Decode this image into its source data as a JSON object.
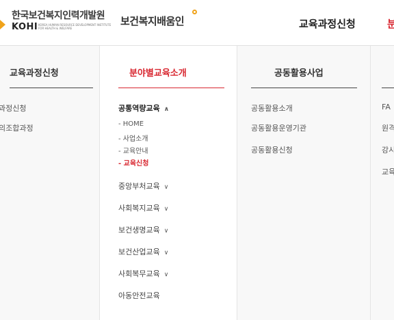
{
  "header": {
    "logo_kr": "한국보건복지인력개발원",
    "logo_en": "KOHI",
    "logo_sub": "KOREA HUMAN RESOURCE DEVELOPMENT INSTITUTE FOR HEALTH & WELFARE",
    "brand": "보건복지배움인",
    "nav_apply": "교육과정신청",
    "nav_next": "분"
  },
  "menu": {
    "col1": {
      "title": "교육과정신청",
      "items": [
        "과정신청",
        "의조합과정"
      ]
    },
    "col2": {
      "title": "분야별교육소개",
      "open_category": "공통역량교육",
      "open_chevron": "∧",
      "subitems": [
        "- HOME",
        "- 사업소개",
        "- 교육안내",
        "- 교육신청"
      ],
      "active_subitem": "- 교육신청",
      "categories": [
        "중앙부처교육",
        "사회복지교육",
        "보건생명교육",
        "보건산업교육",
        "사회복무교육",
        "아동안전교육"
      ],
      "closed_chevron": "∨"
    },
    "col3": {
      "title": "공동활용사업",
      "items": [
        "공동활용소개",
        "공동활용운영기관",
        "공동활용신청"
      ]
    },
    "col4": {
      "items": [
        "FA",
        "원격",
        "강시",
        "교육"
      ]
    }
  },
  "colors": {
    "accent": "#d8262f",
    "logo_accent": "#f0a31a"
  }
}
